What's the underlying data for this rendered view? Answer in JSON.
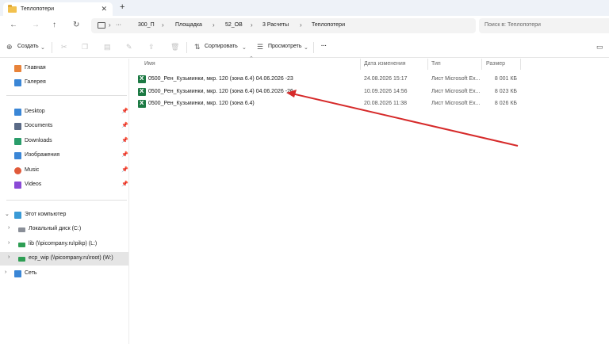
{
  "window": {
    "tab_title": "Теплопотери",
    "close_glyph": "✕",
    "new_tab_glyph": "+"
  },
  "address": {
    "breadcrumbs": [
      "300_П",
      "Площадка",
      "52_ОВ",
      "3 Расчеты",
      "Теплопотери"
    ],
    "ellipsis": "···",
    "search_placeholder": "Поиск в: Теплопотери"
  },
  "toolbar": {
    "create_label": "Создать",
    "sort_label": "Сортировать",
    "view_label": "Просмотреть",
    "more_glyph": "···"
  },
  "sidebar": {
    "quick": [
      {
        "label": "Главная",
        "icon": "home-icon",
        "color": "#e8833a"
      },
      {
        "label": "Галерея",
        "icon": "gallery-icon",
        "color": "#3a86d6"
      }
    ],
    "pinned": [
      {
        "label": "Desktop",
        "icon": "desktop-icon",
        "color": "#3a86d6"
      },
      {
        "label": "Documents",
        "icon": "documents-icon",
        "color": "#5a6a86"
      },
      {
        "label": "Downloads",
        "icon": "downloads-icon",
        "color": "#2a9d6a"
      },
      {
        "label": "Изображения",
        "icon": "pictures-icon",
        "color": "#3a86d6"
      },
      {
        "label": "Music",
        "icon": "music-icon",
        "color": "#e05a3a"
      },
      {
        "label": "Videos",
        "icon": "videos-icon",
        "color": "#8a4ad6"
      }
    ],
    "this_pc": "Этот компьютер",
    "drives": [
      {
        "label": "Локальный диск (C:)"
      },
      {
        "label": "lib (\\\\picompany.ru\\pikp) (L:)"
      },
      {
        "label": "ecp_wip (\\\\picompany.ru\\root) (W:)"
      }
    ],
    "network": "Сеть"
  },
  "columns": {
    "name": "Имя",
    "date": "Дата изменения",
    "type": "Тип",
    "size": "Размер"
  },
  "files": [
    {
      "name": "0500_Рен_Кузьминки, мкр. 120 (зона 6.4) 04.06.2026 -23",
      "date": "24.08.2026 15:17",
      "type": "Лист Microsoft Ex...",
      "size": "8 001 КБ"
    },
    {
      "name": "0500_Рен_Кузьминки, мкр. 120 (зона 6.4) 04.06.2026 -26",
      "date": "10.09.2026 14:56",
      "type": "Лист Microsoft Ex...",
      "size": "8 023 КБ"
    },
    {
      "name": "0500_Рен_Кузьминки, мкр. 120 (зона 6.4)",
      "date": "20.08.2026 11:38",
      "type": "Лист Microsoft Ex...",
      "size": "8 026 КБ"
    }
  ],
  "annotation": {
    "color": "#d62a2a"
  }
}
